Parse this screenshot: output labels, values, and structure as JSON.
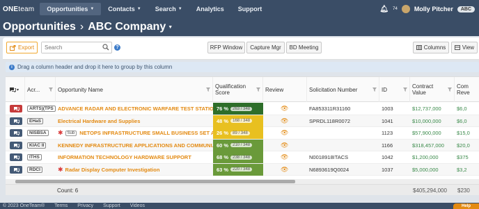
{
  "nav": {
    "logo_bold": "ONE",
    "logo_thin": "team",
    "items": [
      {
        "label": "Opportunities",
        "active": true,
        "caret": true
      },
      {
        "label": "Contacts",
        "caret": true
      },
      {
        "label": "Search",
        "caret": true
      },
      {
        "label": "Analytics"
      },
      {
        "label": "Support"
      }
    ],
    "notif_count": "74",
    "user": "Molly Pitcher",
    "org": "ABC"
  },
  "title": {
    "main": "Opportunities",
    "sep": "›",
    "company": "ABC Company"
  },
  "toolbar": {
    "export": "Export",
    "search_placeholder": "Search",
    "rfp": "RFP Window",
    "capture": "Capture Mgr",
    "bd": "BD Meeting",
    "columns": "Columns",
    "view": "View"
  },
  "group_bar": "Drag a column header and drop it here to group by this column",
  "columns": {
    "acr": "Acr...",
    "name": "Opportunity Name",
    "qual1": "Qualification",
    "qual2": "Score",
    "review": "Review",
    "sol": "Solicitation Number",
    "id": "ID",
    "contract1": "Contract",
    "contract2": "Value",
    "comp1": "Com",
    "comp2": "Reve"
  },
  "rows": [
    {
      "chat_red": true,
      "acr": "ARTS)(TPS",
      "name": "ADVANCE RADAR AND ELECTRONIC WARFARE TEST STATIO...",
      "star": false,
      "sub": false,
      "score": "76 %",
      "frac": "263 / 348",
      "score_color": "#2e6e2a",
      "sol": "FA853311R31160",
      "id": "1003",
      "value": "$12,737,000",
      "comp": "$6,0"
    },
    {
      "chat_red": false,
      "acr": "EHaS",
      "name": "Electrical Hardware and Supplies",
      "star": false,
      "sub": false,
      "score": "48 %",
      "frac": "168 / 348",
      "score_color": "#e8c020",
      "sol": "SPRDL118R0072",
      "id": "1041",
      "value": "$10,000,000",
      "comp": "$6,0"
    },
    {
      "chat_red": false,
      "acr": "NISBSA",
      "name": "NETOPS INFRASTRUCTURE SMALL BUSINESS SET A...",
      "star": true,
      "sub": true,
      "sub_label": "Sub",
      "score": "26 %",
      "frac": "89 / 348",
      "score_color": "#e8c020",
      "sol": "",
      "id": "1123",
      "value": "$57,900,000",
      "comp": "$15,0"
    },
    {
      "chat_red": false,
      "acr": "KIAC II",
      "name": "KENNEDY INFRASTRUCTURE APPLICATIONS AND COMMUNI...",
      "star": false,
      "sub": false,
      "score": "60 %",
      "frac": "210 / 348",
      "score_color": "#6a9a3a",
      "sol": "",
      "id": "1166",
      "value": "$318,457,000",
      "comp": "$20,0"
    },
    {
      "chat_red": false,
      "acr": "ITHS",
      "name": "INFORMATION TECHNOLOGY HARDWARE SUPPORT",
      "star": false,
      "sub": false,
      "score": "68 %",
      "frac": "238 / 348",
      "score_color": "#6a9a3a",
      "sol": "N0018918ITACS",
      "id": "1042",
      "value": "$1,200,000",
      "comp": "$375"
    },
    {
      "chat_red": false,
      "acr": "RDCI",
      "name": "Radar Display Computer Investigation",
      "star": true,
      "sub": false,
      "score": "63 %",
      "frac": "220 / 348",
      "score_color": "#6a9a3a",
      "sol": "N6893619Q0024",
      "id": "1037",
      "value": "$5,000,000",
      "comp": "$3,2"
    }
  ],
  "footer": {
    "count": "Count: 6",
    "total": "$405,294,000",
    "comp_total": "$230"
  },
  "bottom": {
    "copyright": "© 2023 OneTeam®",
    "terms": "Terms",
    "privacy": "Privacy",
    "support": "Support",
    "videos": "Videos",
    "help": "Help"
  }
}
